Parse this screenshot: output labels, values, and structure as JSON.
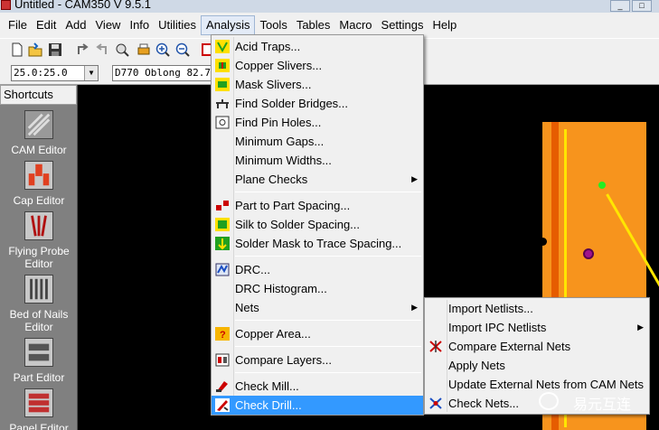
{
  "window": {
    "title": "Untitled - CAM350 V 9.5.1"
  },
  "menubar": [
    "File",
    "Edit",
    "Add",
    "View",
    "Info",
    "Utilities",
    "Analysis",
    "Tools",
    "Tables",
    "Macro",
    "Settings",
    "Help"
  ],
  "toolbar2": {
    "grid_value": "25.0:25.0",
    "dcode_value": "D770  Oblong 82.7"
  },
  "sidebar": {
    "header": "Shortcuts",
    "items": [
      "CAM Editor",
      "Cap Editor",
      "Flying Probe Editor",
      "Bed of Nails Editor",
      "Part Editor",
      "Panel Editor"
    ]
  },
  "analysis_menu": [
    {
      "label": "Acid Traps...",
      "icon": "acid-traps-icon"
    },
    {
      "label": "Copper Slivers...",
      "icon": "copper-slivers-icon"
    },
    {
      "label": "Mask Slivers...",
      "icon": "mask-slivers-icon"
    },
    {
      "label": "Find Solder Bridges...",
      "icon": "solder-bridges-icon"
    },
    {
      "label": "Find Pin Holes...",
      "icon": "pin-holes-icon"
    },
    {
      "label": "Minimum Gaps..."
    },
    {
      "label": "Minimum Widths..."
    },
    {
      "label": "Plane Checks",
      "submenu": true
    },
    {
      "label": "Part to Part Spacing...",
      "icon": "part-spacing-icon"
    },
    {
      "label": "Silk to Solder Spacing...",
      "icon": "silk-spacing-icon"
    },
    {
      "label": "Solder Mask to Trace Spacing...",
      "icon": "mask-trace-icon"
    },
    {
      "label": "DRC...",
      "icon": "drc-icon"
    },
    {
      "label": "DRC Histogram..."
    },
    {
      "label": "Nets",
      "submenu": true
    },
    {
      "label": "Copper Area...",
      "icon": "copper-area-icon"
    },
    {
      "label": "Compare Layers...",
      "icon": "compare-layers-icon"
    },
    {
      "label": "Check Mill...",
      "icon": "check-mill-icon"
    },
    {
      "label": "Check Drill...",
      "icon": "check-drill-icon",
      "highlighted": true
    }
  ],
  "nets_submenu": [
    {
      "label": "Import Netlists..."
    },
    {
      "label": "Import IPC Netlists",
      "submenu": true
    },
    {
      "label": "Compare External Nets",
      "icon": "compare-nets-icon"
    },
    {
      "label": "Apply Nets"
    },
    {
      "label": "Update External Nets from CAM Nets"
    },
    {
      "label": "Check Nets...",
      "icon": "check-nets-icon"
    }
  ],
  "watermark": "易元互连"
}
